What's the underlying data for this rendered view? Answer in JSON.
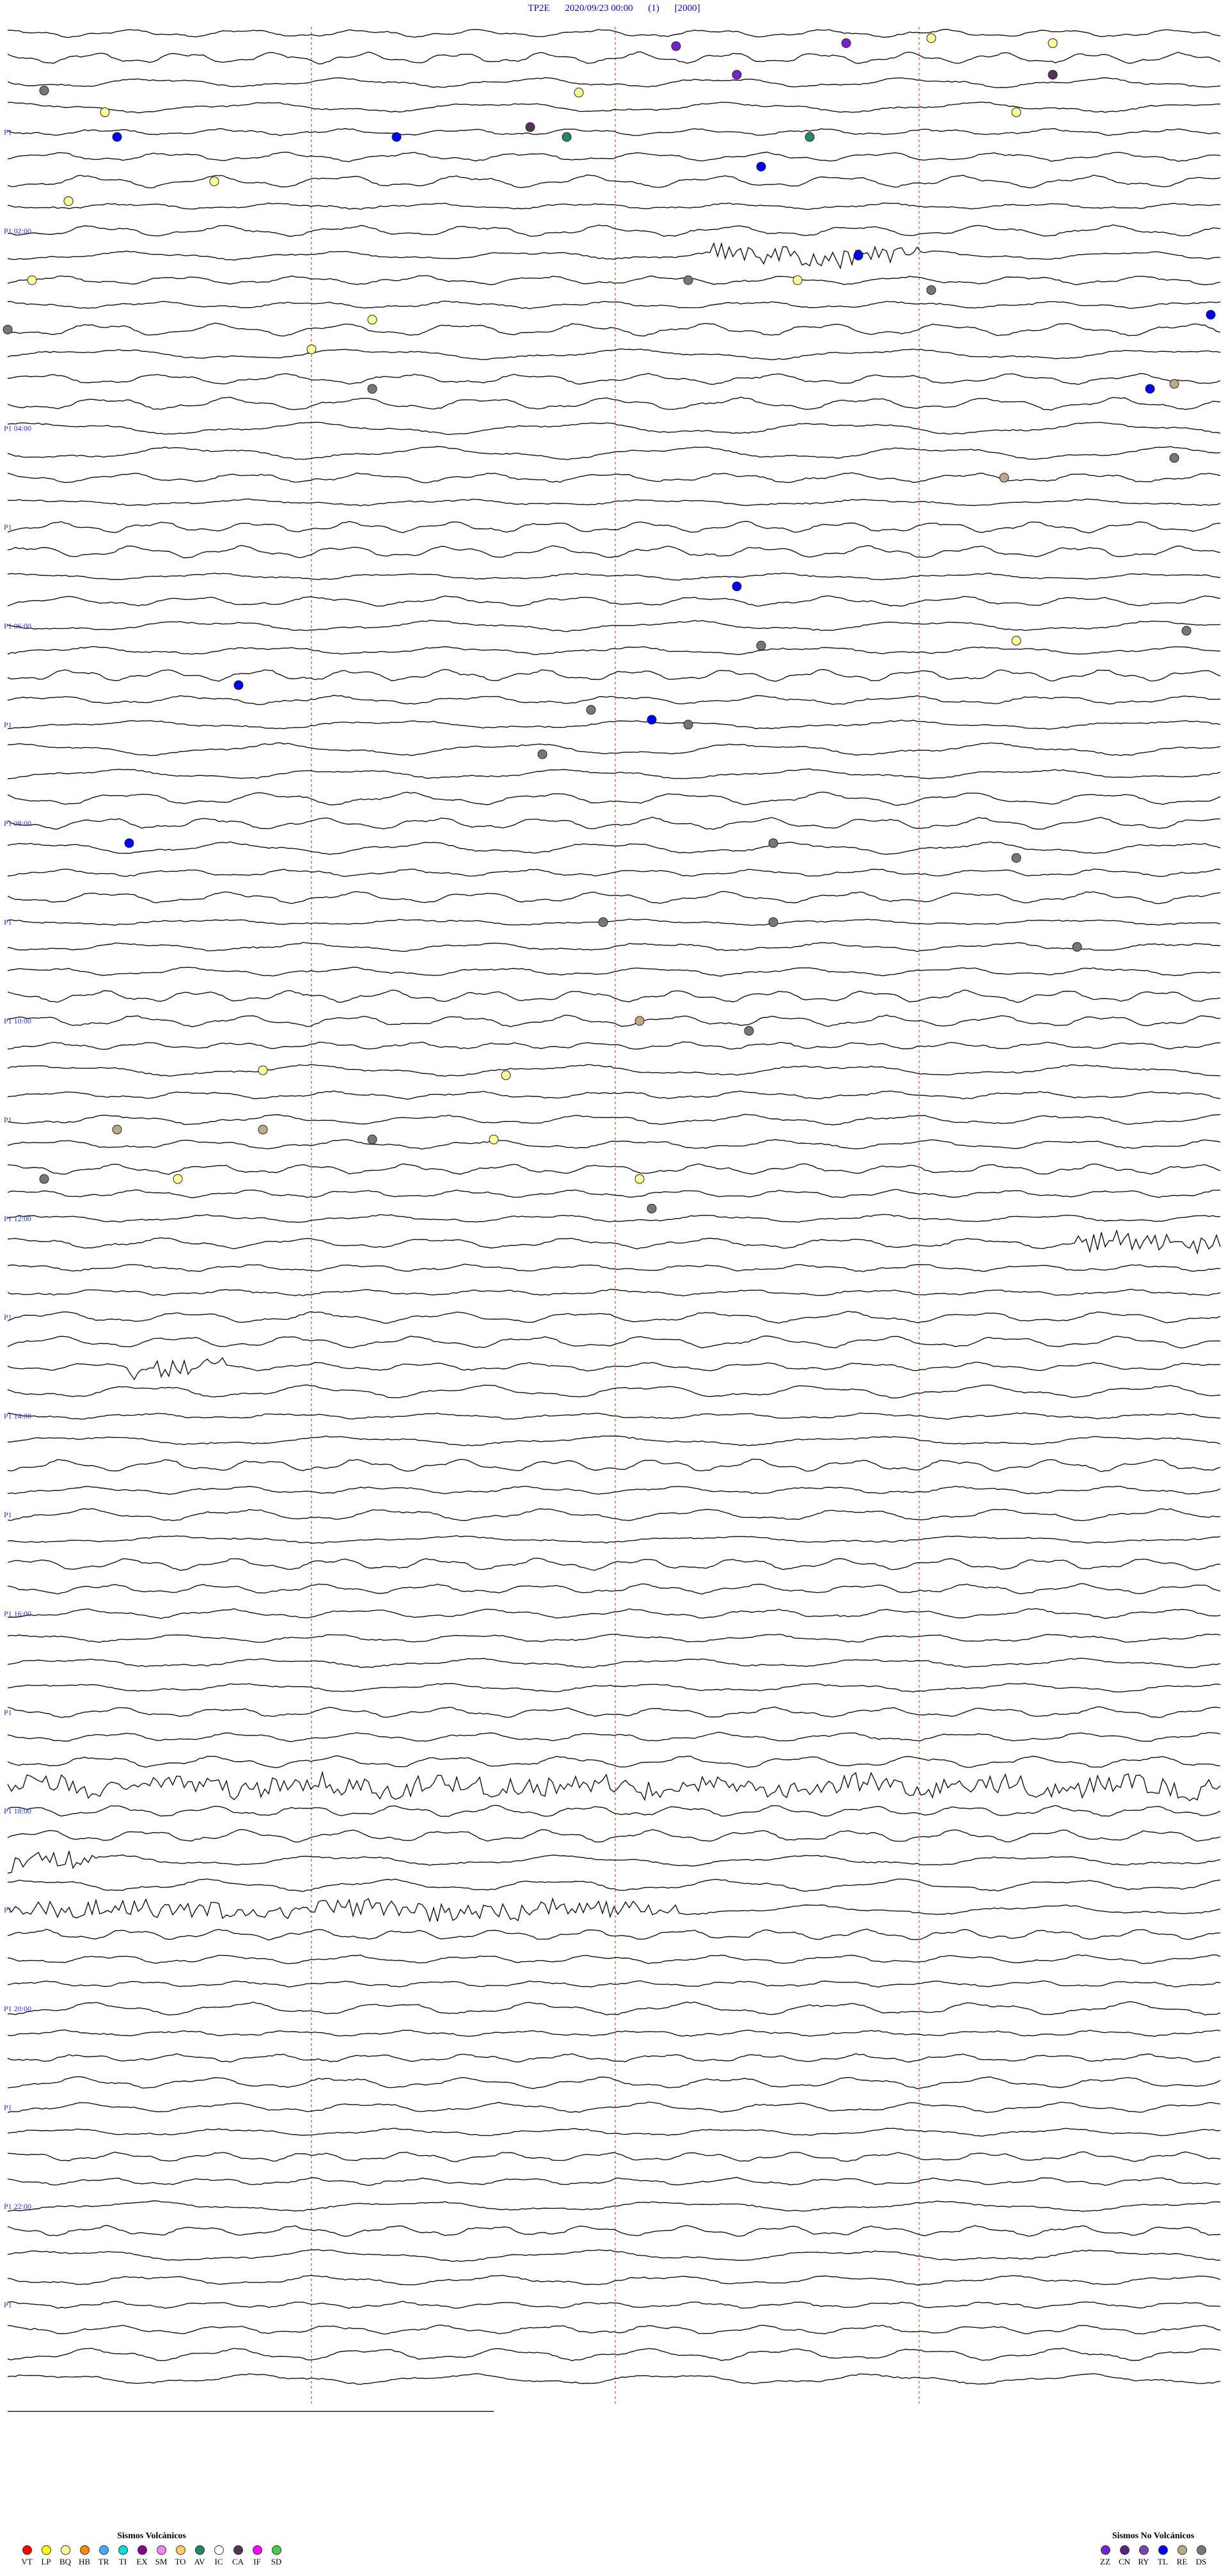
{
  "header": {
    "station": "TP2E",
    "datetime": "2020/09/23 00:00",
    "channel": "(1)",
    "scale": "[2000]"
  },
  "chart_data": {
    "type": "line",
    "hours": [
      "02:00",
      "04:00",
      "06:00",
      "08:00",
      "10:00",
      "12:00",
      "14:00",
      "16:00",
      "18:00",
      "20:00",
      "22:00"
    ],
    "traces_per_hour": 4,
    "total_traces": 96,
    "minute_marks": [
      0,
      15,
      30,
      45,
      60
    ],
    "noise_bursts": [
      {
        "hour": 2.3,
        "start": 0.58,
        "end": 0.75
      },
      {
        "hour": 12.25,
        "start": 0.88,
        "end": 1.0
      },
      {
        "hour": 13.5,
        "start": 0.1,
        "end": 0.18
      },
      {
        "hour": 17.75,
        "start": 0.0,
        "end": 1.0
      },
      {
        "hour": 18.5,
        "start": 0.0,
        "end": 0.07
      },
      {
        "hour": 19.0,
        "start": 0.0,
        "end": 0.55
      }
    ],
    "events": [
      {
        "t": 0.13,
        "x": 0.55,
        "code": "ZZ"
      },
      {
        "t": 0.1,
        "x": 0.69,
        "code": "ZZ"
      },
      {
        "t": 0.1,
        "x": 0.86,
        "code": "BQ"
      },
      {
        "t": 0.05,
        "x": 0.76,
        "code": "BQ"
      },
      {
        "t": 0.58,
        "x": 0.03,
        "code": "DS"
      },
      {
        "t": 0.6,
        "x": 0.47,
        "code": "BQ"
      },
      {
        "t": 0.42,
        "x": 0.6,
        "code": "ZZ"
      },
      {
        "t": 0.42,
        "x": 0.86,
        "code": "CA"
      },
      {
        "t": 0.8,
        "x": 0.08,
        "code": "BQ"
      },
      {
        "t": 0.8,
        "x": 0.83,
        "code": "BQ"
      },
      {
        "t": 0.95,
        "x": 0.43,
        "code": "CA"
      },
      {
        "t": 1.05,
        "x": 0.09,
        "code": "TL"
      },
      {
        "t": 1.05,
        "x": 0.32,
        "code": "TL"
      },
      {
        "t": 1.05,
        "x": 0.46,
        "code": "AV"
      },
      {
        "t": 1.05,
        "x": 0.66,
        "code": "AV"
      },
      {
        "t": 1.35,
        "x": 0.62,
        "code": "TL"
      },
      {
        "t": 1.5,
        "x": 0.17,
        "code": "BQ"
      },
      {
        "t": 1.7,
        "x": 0.05,
        "code": "BQ"
      },
      {
        "t": 2.25,
        "x": 0.7,
        "code": "TL"
      },
      {
        "t": 2.5,
        "x": 0.02,
        "code": "BQ"
      },
      {
        "t": 2.5,
        "x": 0.56,
        "code": "DS"
      },
      {
        "t": 2.5,
        "x": 0.65,
        "code": "BQ"
      },
      {
        "t": 2.6,
        "x": 0.76,
        "code": "DS"
      },
      {
        "t": 2.85,
        "x": 0.99,
        "code": "TL"
      },
      {
        "t": 2.9,
        "x": 0.3,
        "code": "BQ"
      },
      {
        "t": 3.0,
        "x": 0.0,
        "code": "DS"
      },
      {
        "t": 3.2,
        "x": 0.25,
        "code": "BQ"
      },
      {
        "t": 3.55,
        "x": 0.96,
        "code": "RE"
      },
      {
        "t": 3.6,
        "x": 0.3,
        "code": "DS"
      },
      {
        "t": 3.6,
        "x": 0.94,
        "code": "TL"
      },
      {
        "t": 4.3,
        "x": 0.96,
        "code": "DS"
      },
      {
        "t": 4.5,
        "x": 0.82,
        "code": "RE"
      },
      {
        "t": 5.6,
        "x": 0.6,
        "code": "TL"
      },
      {
        "t": 6.05,
        "x": 0.97,
        "code": "DS"
      },
      {
        "t": 6.2,
        "x": 0.62,
        "code": "DS"
      },
      {
        "t": 6.15,
        "x": 0.83,
        "code": "BQ"
      },
      {
        "t": 6.6,
        "x": 0.19,
        "code": "TL"
      },
      {
        "t": 6.85,
        "x": 0.48,
        "code": "DS"
      },
      {
        "t": 6.95,
        "x": 0.53,
        "code": "TL"
      },
      {
        "t": 7.0,
        "x": 0.56,
        "code": "DS"
      },
      {
        "t": 7.3,
        "x": 0.44,
        "code": "DS"
      },
      {
        "t": 8.2,
        "x": 0.1,
        "code": "TL"
      },
      {
        "t": 8.2,
        "x": 0.63,
        "code": "DS"
      },
      {
        "t": 8.35,
        "x": 0.83,
        "code": "DS"
      },
      {
        "t": 9.0,
        "x": 0.49,
        "code": "DS"
      },
      {
        "t": 9.0,
        "x": 0.63,
        "code": "DS"
      },
      {
        "t": 9.25,
        "x": 0.88,
        "code": "DS"
      },
      {
        "t": 10.0,
        "x": 0.52,
        "code": "RE"
      },
      {
        "t": 10.1,
        "x": 0.61,
        "code": "DS"
      },
      {
        "t": 10.5,
        "x": 0.21,
        "code": "BQ"
      },
      {
        "t": 10.55,
        "x": 0.41,
        "code": "BQ"
      },
      {
        "t": 11.1,
        "x": 0.09,
        "code": "RE"
      },
      {
        "t": 11.1,
        "x": 0.21,
        "code": "RE"
      },
      {
        "t": 11.2,
        "x": 0.3,
        "code": "DS"
      },
      {
        "t": 11.2,
        "x": 0.4,
        "code": "BQ"
      },
      {
        "t": 11.6,
        "x": 0.03,
        "code": "DS"
      },
      {
        "t": 11.6,
        "x": 0.14,
        "code": "BQ"
      },
      {
        "t": 11.6,
        "x": 0.52,
        "code": "BQ"
      },
      {
        "t": 11.9,
        "x": 0.53,
        "code": "DS"
      }
    ]
  },
  "legend_volcanic": {
    "title": "Sismos Volcánicos",
    "items": [
      {
        "code": "VT",
        "color": "#ff0000"
      },
      {
        "code": "LP",
        "color": "#ffff00"
      },
      {
        "code": "BQ",
        "color": "#ffff99"
      },
      {
        "code": "HB",
        "color": "#ff8800"
      },
      {
        "code": "TR",
        "color": "#44aaff"
      },
      {
        "code": "TI",
        "color": "#00dddd"
      },
      {
        "code": "EX",
        "color": "#880088"
      },
      {
        "code": "SM",
        "color": "#ee88ee"
      },
      {
        "code": "TO",
        "color": "#ffcc66"
      },
      {
        "code": "AV",
        "color": "#228866"
      },
      {
        "code": "IC",
        "color": "#ffffff"
      },
      {
        "code": "CA",
        "color": "#553355"
      },
      {
        "code": "IF",
        "color": "#ff00ff"
      },
      {
        "code": "SD",
        "color": "#44cc44"
      }
    ]
  },
  "legend_nonvolcanic": {
    "title": "Sismos No Volcánicos",
    "items": [
      {
        "code": "ZZ",
        "color": "#7722cc"
      },
      {
        "code": "CN",
        "color": "#552288"
      },
      {
        "code": "RY",
        "color": "#7744aa"
      },
      {
        "code": "TL",
        "color": "#0000ff"
      },
      {
        "code": "RE",
        "color": "#bbaa88"
      },
      {
        "code": "DS",
        "color": "#777777"
      }
    ]
  }
}
